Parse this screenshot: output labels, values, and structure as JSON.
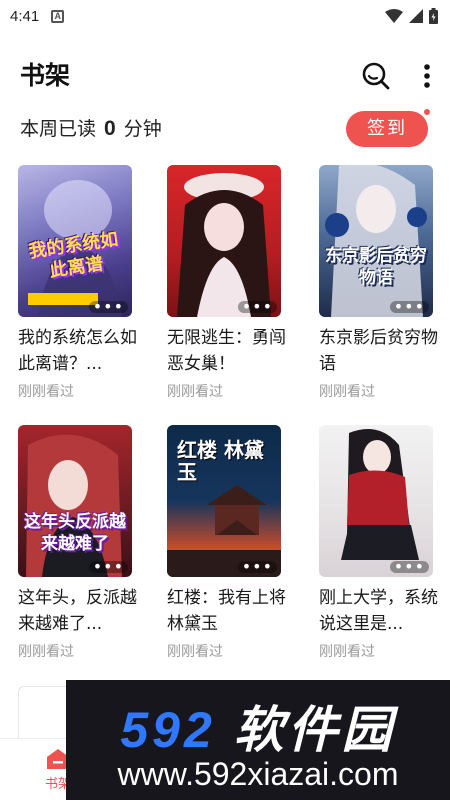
{
  "status_bar": {
    "time": "4:41",
    "notification_glyph": "A"
  },
  "header": {
    "title": "书架"
  },
  "weekly": {
    "prefix": "本周已读",
    "minutes": "0",
    "suffix": "分钟"
  },
  "signin": {
    "label": "签到"
  },
  "books": [
    {
      "title": "我的系统怎么如此离谱？...",
      "status": "刚刚看过",
      "cover_text": "我的系统如此离谱"
    },
    {
      "title": "无限逃生：勇闯恶女巢！",
      "status": "刚刚看过",
      "cover_text": ""
    },
    {
      "title": "东京影后贫穷物语",
      "status": "刚刚看过",
      "cover_text": "东京影后贫穷物语"
    },
    {
      "title": "这年头，反派越来越难了...",
      "status": "刚刚看过",
      "cover_text": "这年头反派越来越难了"
    },
    {
      "title": "红楼：我有上将林黛玉",
      "status": "刚刚看过",
      "cover_text": "红楼 林黛玉"
    },
    {
      "title": "刚上大学，系统说这里是...",
      "status": "刚刚看过",
      "cover_text": ""
    }
  ],
  "bottom_nav": {
    "shelf_label": "书架"
  },
  "watermark": {
    "brand_num": "592",
    "brand_cn": "软件园",
    "url": "www.592xiazai.com"
  },
  "colors": {
    "accent": "#ef5350",
    "watermark_blue": "#2f78ff",
    "watermark_bg": "#17161c"
  }
}
